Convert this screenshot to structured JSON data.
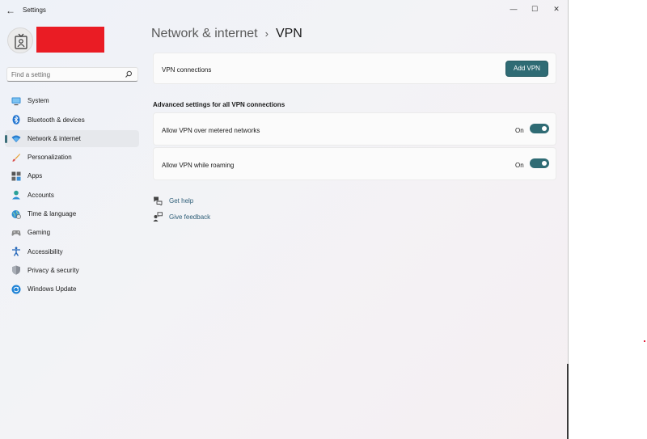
{
  "window": {
    "title": "Settings",
    "controls": {
      "minimize": "—",
      "maximize": "☐",
      "close": "✕"
    },
    "back_icon": "←"
  },
  "search": {
    "placeholder": "Find a setting",
    "value": ""
  },
  "sidebar": {
    "items": [
      {
        "label": "System",
        "icon": "monitor-icon",
        "selected": false
      },
      {
        "label": "Bluetooth & devices",
        "icon": "bluetooth-icon",
        "selected": false
      },
      {
        "label": "Network & internet",
        "icon": "wifi-icon",
        "selected": true
      },
      {
        "label": "Personalization",
        "icon": "brush-icon",
        "selected": false
      },
      {
        "label": "Apps",
        "icon": "apps-icon",
        "selected": false
      },
      {
        "label": "Accounts",
        "icon": "person-icon",
        "selected": false
      },
      {
        "label": "Time & language",
        "icon": "globe-clock-icon",
        "selected": false
      },
      {
        "label": "Gaming",
        "icon": "gamepad-icon",
        "selected": false
      },
      {
        "label": "Accessibility",
        "icon": "accessibility-icon",
        "selected": false
      },
      {
        "label": "Privacy & security",
        "icon": "shield-icon",
        "selected": false
      },
      {
        "label": "Windows Update",
        "icon": "update-icon",
        "selected": false
      }
    ]
  },
  "breadcrumb": {
    "parent": "Network & internet",
    "separator": "›",
    "current": "VPN"
  },
  "vpn": {
    "label": "VPN connections",
    "add_button": "Add VPN"
  },
  "advanced": {
    "header": "Advanced settings for all VPN connections",
    "toggles": [
      {
        "label": "Allow VPN over metered networks",
        "state": "On",
        "on": true
      },
      {
        "label": "Allow VPN while roaming",
        "state": "On",
        "on": true
      }
    ]
  },
  "help": {
    "get_help": "Get help",
    "give_feedback": "Give feedback"
  },
  "colors": {
    "accent": "#2f6b74",
    "redaction": "#ea1c24",
    "link": "#2f5f78"
  }
}
